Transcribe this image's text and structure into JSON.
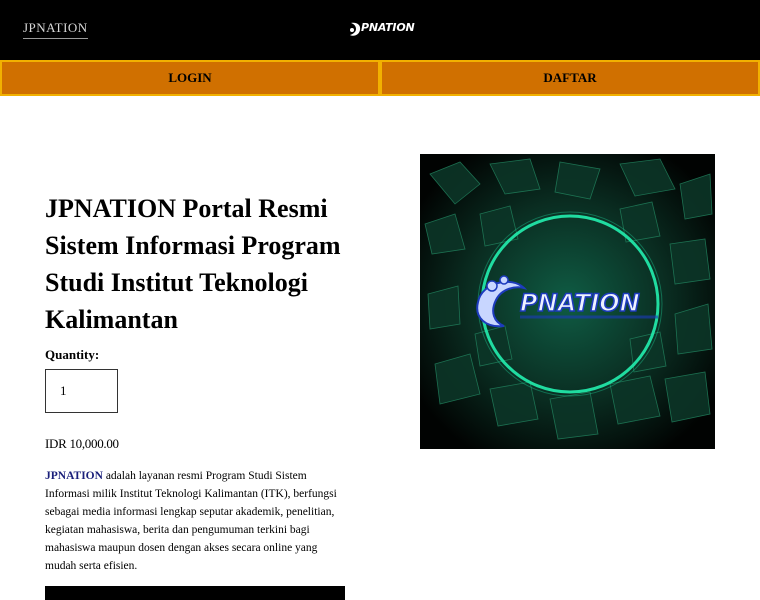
{
  "header": {
    "brand_left": "JPNATION",
    "logo_text": "PNATION",
    "logo_icon": "jpnation-logo-icon"
  },
  "nav": {
    "login": "LOGIN",
    "daftar": "DAFTAR"
  },
  "product": {
    "title": "JPNATION  Portal Resmi Sistem Informasi Program Studi Institut Teknologi Kalimantan",
    "quantity_label": "Quantity:",
    "quantity_value": "1",
    "price": "IDR 10,000.00",
    "description_highlight": "JPNATION",
    "description_rest": " adalah layanan resmi Program Studi Sistem Informasi milik Institut Teknologi Kalimantan (ITK), berfungsi sebagai media informasi lengkap seputar akademik, penelitian, kegiatan mahasiswa, berita dan pengumuman terkini bagi mahasiswa maupun dosen dengan akses secara online yang mudah serta efisien."
  },
  "hero": {
    "logo_text": "PNATION",
    "accent_color": "#22e6a8",
    "background_color": "#020806"
  },
  "colors": {
    "nav_bg": "#d07000",
    "nav_border": "#f2b100",
    "topbar_bg": "#000000",
    "link_highlight": "#1a1f7a"
  }
}
